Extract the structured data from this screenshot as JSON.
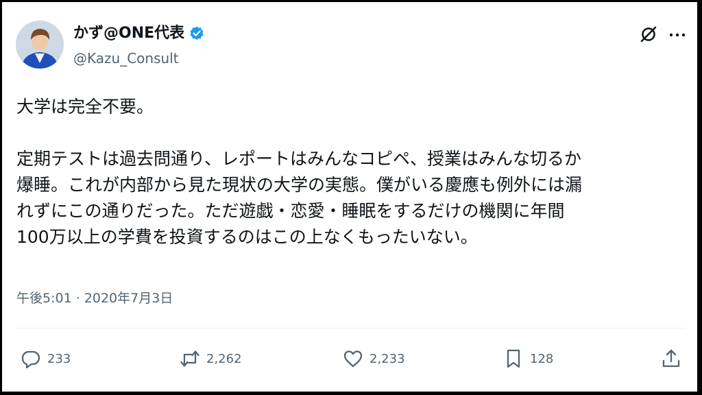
{
  "user": {
    "display_name": "かず@ONE代表",
    "handle": "@Kazu_Consult",
    "verified": true
  },
  "tweet": {
    "paragraph1": "大学は完全不要。",
    "lines": [
      "定期テストは過去問通り、レポートはみんなコピペ、授業はみんな切るか",
      "爆睡。これが内部から見た現状の大学の実態。僕がいる慶應も例外には漏",
      "れずにこの通りだった。ただ遊戯・恋愛・睡眠をするだけの機関に年間",
      "100万以上の学費を投資するのはこの上なくもったいない。"
    ],
    "timestamp": "午後5:01 · 2020年7月3日"
  },
  "actions": {
    "replies": "233",
    "reposts": "2,262",
    "likes": "2,233",
    "bookmarks": "128"
  },
  "icons": {
    "verified": "verified-badge-icon",
    "grok": "grok-icon",
    "more": "more-icon",
    "reply": "reply-icon",
    "repost": "repost-icon",
    "like": "heart-icon",
    "bookmark": "bookmark-icon",
    "share": "share-icon"
  },
  "colors": {
    "text": "#0f1419",
    "secondary": "#536471",
    "verified": "#1d9bf0",
    "divider": "#eff3f4"
  }
}
